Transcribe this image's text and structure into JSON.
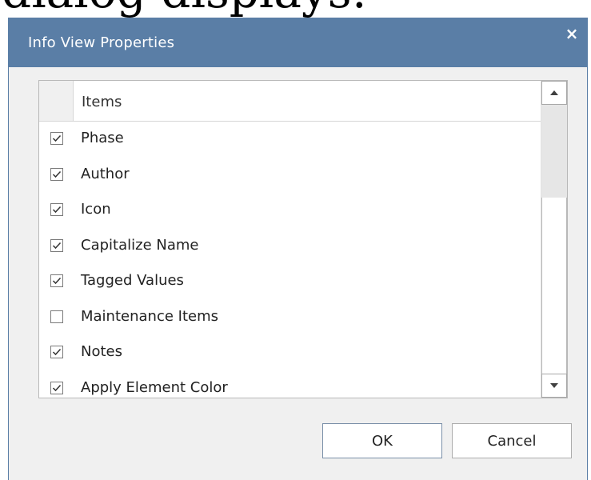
{
  "background": {
    "partial_text": "dialog displays:"
  },
  "dialog": {
    "title": "Info View Properties",
    "close_glyph": "×",
    "title_bar_color": "#5a7ea6"
  },
  "list": {
    "column_header": "Items",
    "items": [
      {
        "label": "Phase",
        "checked": true
      },
      {
        "label": "Author",
        "checked": true
      },
      {
        "label": "Icon",
        "checked": true
      },
      {
        "label": "Capitalize Name",
        "checked": true
      },
      {
        "label": "Tagged Values",
        "checked": true
      },
      {
        "label": "Maintenance Items",
        "checked": false
      },
      {
        "label": "Notes",
        "checked": true
      },
      {
        "label": "Apply Element Color",
        "checked": true
      }
    ]
  },
  "buttons": {
    "ok_label": "OK",
    "cancel_label": "Cancel"
  },
  "icons": {
    "close": "close-icon",
    "scroll_up": "arrow-up-icon",
    "scroll_down": "arrow-down-icon",
    "checkmark": "checkmark-icon"
  }
}
